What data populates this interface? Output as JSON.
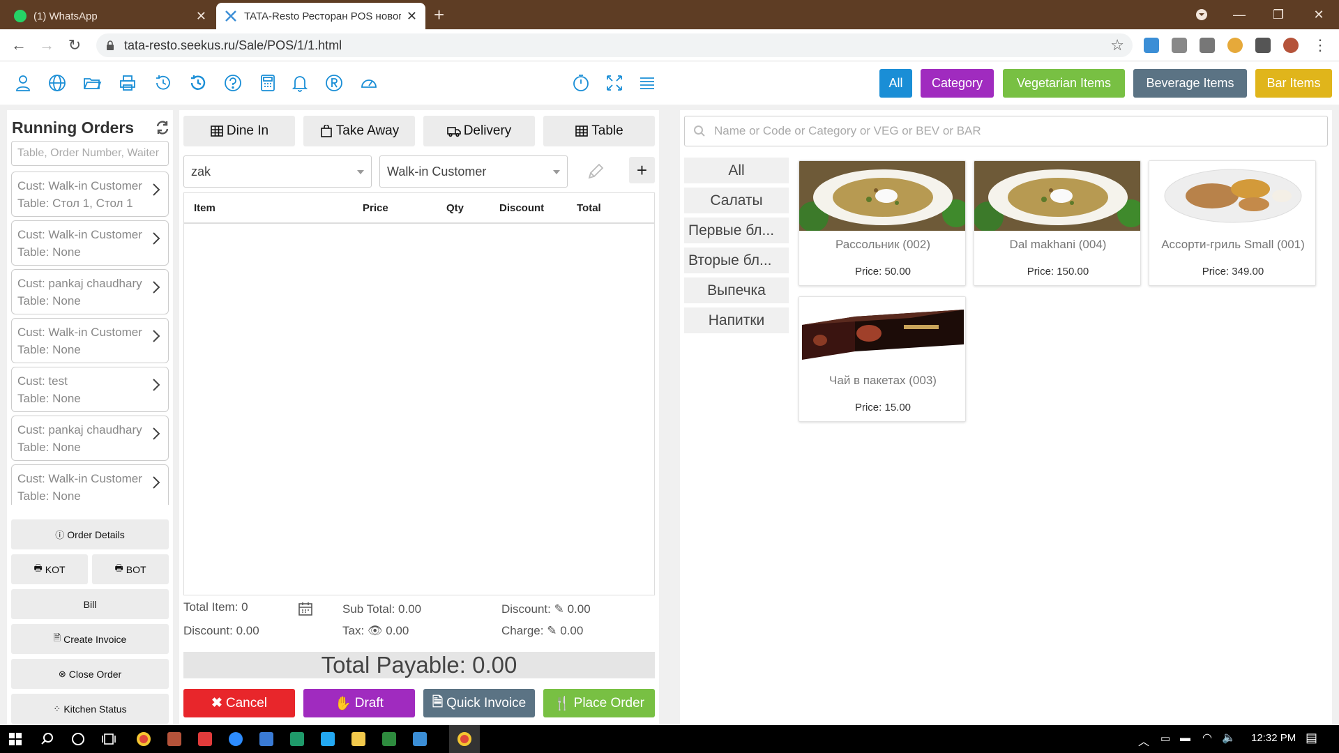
{
  "browser": {
    "tabs": [
      {
        "title": "(1) WhatsApp",
        "active": false
      },
      {
        "title": "TATA-Resto Ресторан POS новог",
        "active": true
      }
    ],
    "url": "tata-resto.seekus.ru/Sale/POS/1/1.html"
  },
  "category_buttons": [
    {
      "label": "All",
      "color": "#1a8ed6"
    },
    {
      "label": "Category",
      "color": "#a02bbf"
    },
    {
      "label": "Vegetarian Items",
      "color": "#78c043"
    },
    {
      "label": "Beverage Items",
      "color": "#5b7384"
    },
    {
      "label": "Bar Items",
      "color": "#e0b51b"
    }
  ],
  "running_orders": {
    "title": "Running Orders",
    "search_placeholder": "Table, Order Number, Waiter",
    "orders": [
      {
        "cust": "Cust: Walk-in Customer",
        "table": "Table: Стол 1, Стол 1"
      },
      {
        "cust": "Cust: Walk-in Customer",
        "table": "Table: None"
      },
      {
        "cust": "Cust: pankaj chaudhary",
        "table": "Table: None"
      },
      {
        "cust": "Cust: Walk-in Customer",
        "table": "Table: None"
      },
      {
        "cust": "Cust: test",
        "table": "Table: None"
      },
      {
        "cust": "Cust: pankaj chaudhary",
        "table": "Table: None"
      },
      {
        "cust": "Cust: Walk-in Customer",
        "table": "Table: None"
      }
    ],
    "buttons": {
      "order_details": "Order Details",
      "kot": "KOT",
      "bot": "BOT",
      "bill": "Bill",
      "create_invoice": "Create Invoice",
      "close_order": "Close Order",
      "kitchen_status": "Kitchen Status"
    }
  },
  "order_panel": {
    "order_types": [
      "Dine In",
      "Take Away",
      "Delivery",
      "Table"
    ],
    "waiter": "zak",
    "customer": "Walk-in Customer",
    "cart_columns": [
      "Item",
      "Price",
      "Qty",
      "Discount",
      "Total"
    ],
    "summary": {
      "total_item": "Total Item: 0",
      "sub_total": "Sub Total: 0.00",
      "discount_edit_label": "Discount:",
      "discount_edit_value": "0.00",
      "discount": "Discount: 0.00",
      "tax_label": "Tax:",
      "tax_value": "0.00",
      "charge_label": "Charge:",
      "charge_value": "0.00"
    },
    "total_payable": "Total Payable: 0.00",
    "actions": {
      "cancel": "Cancel",
      "draft": "Draft",
      "quick_invoice": "Quick Invoice",
      "place_order": "Place Order"
    },
    "action_colors": {
      "cancel": "#e8262b",
      "draft": "#a02bbf",
      "quick_invoice": "#5b7384",
      "place_order": "#78c043"
    }
  },
  "menu": {
    "search_placeholder": "Name or Code or Category or VEG or BEV or BAR",
    "categories": [
      "All",
      "Салаты",
      "Первые бл...",
      "Вторые бл...",
      "Выпечка",
      "Напитки"
    ],
    "items": [
      {
        "name": "Рассольник (002)",
        "price": "Price: 50.00",
        "image": "soup"
      },
      {
        "name": "Dal makhani (004)",
        "price": "Price: 150.00",
        "image": "soup"
      },
      {
        "name": "Ассорти-гриль Small (001)",
        "price": "Price: 349.00",
        "image": "grill-plate"
      },
      {
        "name": "Чай в пакетах (003)",
        "price": "Price: 15.00",
        "image": "tea-box"
      }
    ]
  },
  "taskbar": {
    "time": "12:32 PM"
  }
}
